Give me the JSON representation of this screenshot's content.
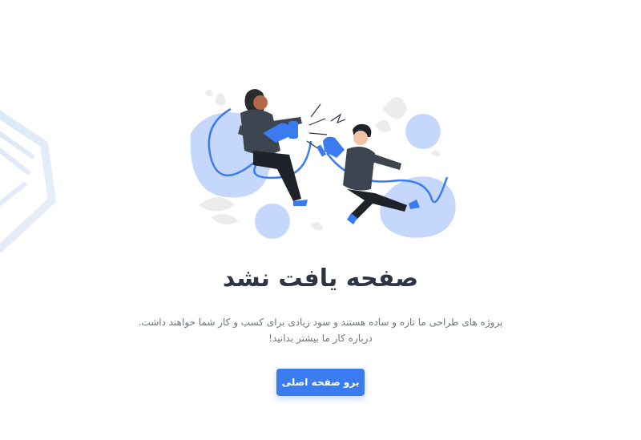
{
  "page": {
    "title": "صفحه یافت نشد",
    "description": "پروژه های طراحی ما تازه و ساده هستند و سود زیادی برای کسب و کار شما خواهند داشت. درباره کار ما بیشتر بدانید!",
    "home_button_label": "برو صفحه اصلی"
  },
  "colors": {
    "accent": "#3b7bf0",
    "blob": "#c5d8fb",
    "title": "#2b3544",
    "text": "#6b7684"
  },
  "icons": {
    "illustration": "unplugged-cable-illustration",
    "decor": "hexagon-outline-decor"
  }
}
